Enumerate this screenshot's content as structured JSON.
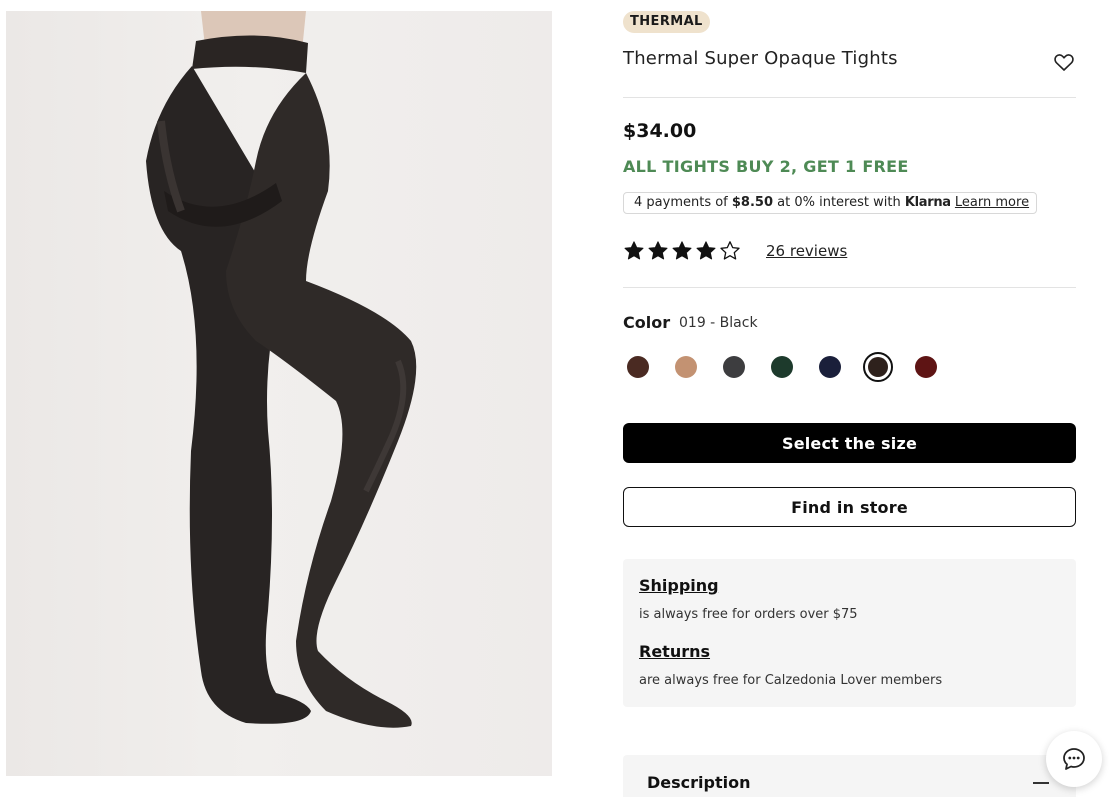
{
  "product": {
    "badge": "THERMAL",
    "title": "Thermal Super Opaque Tights",
    "price": "$34.00",
    "promo": "ALL TIGHTS BUY 2, GET 1 FREE"
  },
  "klarna": {
    "prefix": "4 payments of ",
    "amount": "$8.50",
    "middle": " at 0% interest with ",
    "brand": "Klarna",
    "link": "Learn more"
  },
  "rating": {
    "stars": 4,
    "max": 5,
    "reviews_link": "26 reviews"
  },
  "color": {
    "label": "Color",
    "selected_value": "019 - Black",
    "swatches": [
      {
        "color": "#4a2a22",
        "selected": false
      },
      {
        "color": "#c39272",
        "selected": false
      },
      {
        "color": "#3d3d3f",
        "selected": false
      },
      {
        "color": "#1d3a2c",
        "selected": false
      },
      {
        "color": "#1a1f3a",
        "selected": false
      },
      {
        "color": "#2e211c",
        "selected": true
      },
      {
        "color": "#5e1414",
        "selected": false
      }
    ]
  },
  "buttons": {
    "select_size": "Select the size",
    "find_in_store": "Find in store"
  },
  "info": {
    "shipping_title": "Shipping",
    "shipping_text": "is always free for orders over $75",
    "returns_title": "Returns",
    "returns_text": "are always free for Calzedonia Lover members"
  },
  "description": {
    "label": "Description"
  },
  "icons": {
    "heart": "heart-outline-icon",
    "chat": "chat-bubble-icon",
    "collapse": "minus-icon"
  },
  "colors": {
    "promo_green": "#4e8a55",
    "badge_bg": "#efe2cd",
    "primary_button": "#000000"
  }
}
